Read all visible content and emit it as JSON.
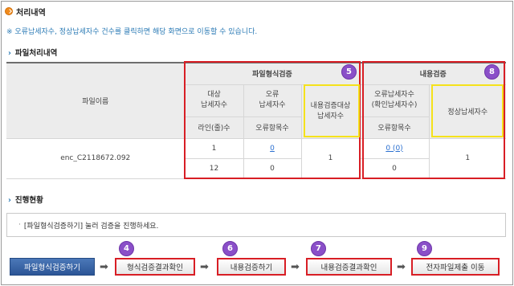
{
  "page": {
    "title": "처리내역",
    "note": "※ 오류납세자수, 정상납세자수 건수를 클릭하면 해당 화면으로 이동할 수 있습니다."
  },
  "file_section": {
    "heading": "파일처리내역",
    "table": {
      "col_filename": "파일이름",
      "group_format": "파일형식검증",
      "group_content": "내용검증",
      "format_target_top": "대상\n납세자수",
      "format_target_bottom": "라인(줄)수",
      "format_error_top": "오류\n납세자수",
      "format_error_bottom": "오류항목수",
      "format_content_target": "내용검증대상\n납세자수",
      "content_error_top": "오류납세자수\n(확인납세자수)",
      "content_error_bottom": "오류항목수",
      "content_normal": "정상납세자수",
      "row": {
        "filename": "enc_C2118672.092",
        "target_taxpayers": "1",
        "target_lines": "12",
        "error_taxpayers": "0",
        "error_items": "0",
        "content_target": "1",
        "content_error_taxpayers": "0 (0)",
        "content_error_items": "0",
        "normal_taxpayers": "1"
      }
    },
    "badges": {
      "format": "5",
      "content": "8"
    }
  },
  "progress_section": {
    "heading": "진행현황",
    "message": "[파일형식검증하기] 눌러 검증을 진행하세요."
  },
  "buttons": {
    "format_check": "파일형식검증하기",
    "format_result": "형식검증결과확인",
    "content_check": "내용검증하기",
    "content_result": "내용검증결과확인",
    "submit": "전자파일제출 이동"
  },
  "step_badges": {
    "format_result": "4",
    "content_check": "6",
    "content_result": "7",
    "submit": "9"
  },
  "colors": {
    "accent_blue": "#2a7ab5",
    "highlight_red": "#d81e25",
    "highlight_yellow": "#f5e21b",
    "badge_purple": "#8a4fc8",
    "primary_button": "#2c5596"
  }
}
